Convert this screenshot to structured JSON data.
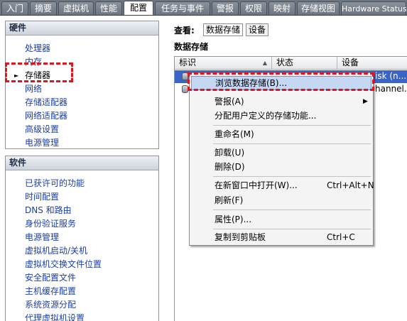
{
  "tabs": [
    {
      "label": "入门"
    },
    {
      "label": "摘要"
    },
    {
      "label": "虚拟机"
    },
    {
      "label": "性能"
    },
    {
      "label": "配置",
      "active": true
    },
    {
      "label": "任务与事件"
    },
    {
      "label": "警报"
    },
    {
      "label": "权限"
    },
    {
      "label": "映射"
    },
    {
      "label": "存储视图"
    },
    {
      "label": "Hardware Status"
    }
  ],
  "hardware": {
    "title": "硬件",
    "items": [
      "处理器",
      "内存",
      "存储器",
      "网络",
      "存储适配器",
      "网络适配器",
      "高级设置",
      "电源管理"
    ],
    "selected": "存储器"
  },
  "software": {
    "title": "软件",
    "items": [
      "已获许可的功能",
      "时间配置",
      "DNS 和路由",
      "身份验证服务",
      "电源管理",
      "虚拟机启动/关机",
      "虚拟机交换文件位置",
      "安全配置文件",
      "主机缓存配置",
      "系统资源分配",
      "代理虚拟机设置"
    ]
  },
  "view": {
    "label": "查看:",
    "options": [
      "数据存储",
      "设备"
    ],
    "active": "数据存储"
  },
  "datastore": {
    "title": "数据存储",
    "columns": [
      "标识",
      "状态",
      "设备"
    ],
    "rows": [
      {
        "device": "isk (n..."
      },
      {
        "device": "hannel..."
      }
    ]
  },
  "context_menu": {
    "items": [
      {
        "label": "浏览数据存储(B)...",
        "shortcut": "",
        "hover": true
      },
      {
        "label": "警报(A)",
        "shortcut": "",
        "submenu": true
      },
      {
        "label": "分配用户定义的存储功能...",
        "shortcut": ""
      },
      {
        "label": "重命名(M)",
        "shortcut": ""
      },
      {
        "label": "卸载(U)",
        "shortcut": ""
      },
      {
        "label": "删除(D)",
        "shortcut": ""
      },
      {
        "label": "在新窗口中打开(W)...",
        "shortcut": "Ctrl+Alt+N"
      },
      {
        "label": "刷新(F)",
        "shortcut": ""
      },
      {
        "label": "属性(P)...",
        "shortcut": ""
      },
      {
        "label": "复制到剪贴板",
        "shortcut": "Ctrl+C"
      }
    ]
  },
  "colors": {
    "link": "#1a3fa8",
    "highlight": "#e0141c",
    "selection": "#3b64c8",
    "menu_hover": "#c5d7f2"
  }
}
